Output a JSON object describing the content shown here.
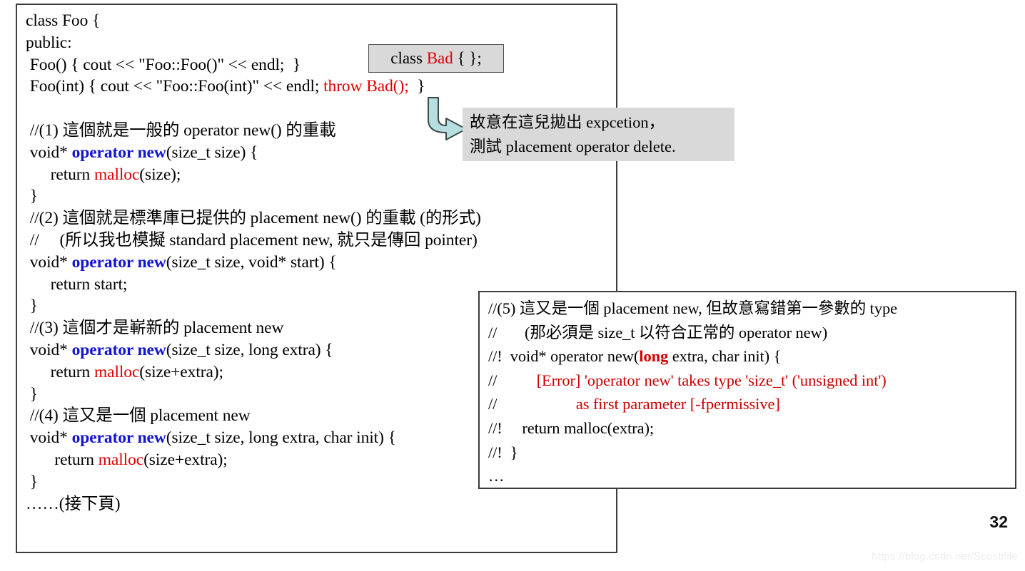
{
  "slide": {
    "page_number": "32",
    "watermark": "https://blog.csdn.net/Scostifile"
  },
  "colors": {
    "keyword_blue": "#1414d2",
    "error_red": "#cc0000",
    "callout_gray": "#d9d9d9",
    "arrow_fill": "#b7dfe0",
    "arrow_stroke": "#3c4a4a",
    "box_border": "#3b3b3b",
    "watermark_gray": "#ededed"
  },
  "main_code": {
    "lines": [
      {
        "id": "l1",
        "parts": [
          {
            "t": "class Foo {",
            "s": "plain"
          }
        ]
      },
      {
        "id": "l2",
        "parts": [
          {
            "t": "public:",
            "s": "plain"
          }
        ]
      },
      {
        "id": "l3",
        "parts": [
          {
            "t": " Foo() { cout << \"Foo::Foo()\" << endl;  }",
            "s": "plain"
          }
        ]
      },
      {
        "id": "l4",
        "parts": [
          {
            "t": " Foo(int) { cout << \"Foo::Foo(int)\" << endl; ",
            "s": "plain"
          },
          {
            "t": "throw Bad();",
            "s": "red"
          },
          {
            "t": "  }",
            "s": "plain"
          }
        ]
      },
      {
        "id": "l5",
        "parts": [
          {
            "t": "",
            "s": "plain"
          }
        ]
      },
      {
        "id": "l6",
        "parts": [
          {
            "t": " //(1) 這個就是一般的 operator new() 的重載",
            "s": "plain"
          }
        ]
      },
      {
        "id": "l7",
        "parts": [
          {
            "t": " void* ",
            "s": "plain"
          },
          {
            "t": "operator new",
            "s": "kw"
          },
          {
            "t": "(size_t size) {",
            "s": "plain"
          }
        ]
      },
      {
        "id": "l8",
        "parts": [
          {
            "t": "      return ",
            "s": "plain"
          },
          {
            "t": "malloc",
            "s": "red"
          },
          {
            "t": "(size);",
            "s": "plain"
          }
        ]
      },
      {
        "id": "l9",
        "parts": [
          {
            "t": " }",
            "s": "plain"
          }
        ]
      },
      {
        "id": "l10",
        "parts": [
          {
            "t": " //(2) 這個就是標準庫已提供的 placement new() 的重載 (的形式)",
            "s": "plain"
          }
        ]
      },
      {
        "id": "l11",
        "parts": [
          {
            "t": " //     (所以我也模擬 standard placement new, 就只是傳回 pointer)",
            "s": "plain"
          }
        ]
      },
      {
        "id": "l12",
        "parts": [
          {
            "t": " void* ",
            "s": "plain"
          },
          {
            "t": "operator new",
            "s": "kw"
          },
          {
            "t": "(size_t size, void* start) {",
            "s": "plain"
          }
        ]
      },
      {
        "id": "l13",
        "parts": [
          {
            "t": "      return start;",
            "s": "plain"
          }
        ]
      },
      {
        "id": "l14",
        "parts": [
          {
            "t": " }",
            "s": "plain"
          }
        ]
      },
      {
        "id": "l15",
        "parts": [
          {
            "t": " //(3) 這個才是嶄新的 placement new",
            "s": "plain"
          }
        ]
      },
      {
        "id": "l16",
        "parts": [
          {
            "t": " void* ",
            "s": "plain"
          },
          {
            "t": "operator new",
            "s": "kw"
          },
          {
            "t": "(size_t size, long extra) {",
            "s": "plain"
          }
        ]
      },
      {
        "id": "l17",
        "parts": [
          {
            "t": "      return ",
            "s": "plain"
          },
          {
            "t": "malloc",
            "s": "red"
          },
          {
            "t": "(size+extra);",
            "s": "plain"
          }
        ]
      },
      {
        "id": "l18",
        "parts": [
          {
            "t": " }",
            "s": "plain"
          }
        ]
      },
      {
        "id": "l19",
        "parts": [
          {
            "t": " //(4) 這又是一個 placement new",
            "s": "plain"
          }
        ]
      },
      {
        "id": "l20",
        "parts": [
          {
            "t": " void* ",
            "s": "plain"
          },
          {
            "t": "operator new",
            "s": "kw"
          },
          {
            "t": "(size_t size, long extra, char init) {",
            "s": "plain"
          }
        ]
      },
      {
        "id": "l21",
        "parts": [
          {
            "t": "       return ",
            "s": "plain"
          },
          {
            "t": "malloc",
            "s": "red"
          },
          {
            "t": "(size+extra);",
            "s": "plain"
          }
        ]
      },
      {
        "id": "l22",
        "parts": [
          {
            "t": " }",
            "s": "plain"
          }
        ]
      },
      {
        "id": "l23",
        "parts": [
          {
            "t": "……(接下頁)",
            "s": "plain"
          }
        ]
      }
    ]
  },
  "class_bad_box": {
    "parts": [
      {
        "t": "class ",
        "s": "plain"
      },
      {
        "t": "Bad",
        "s": "red"
      },
      {
        "t": " { };",
        "s": "plain"
      }
    ]
  },
  "note_callout": {
    "line1": "故意在這兒拋出 expcetion，",
    "line2": "測試 placement operator delete."
  },
  "right_note_box": {
    "lines": [
      {
        "id": "r1",
        "parts": [
          {
            "t": "//(5) 這又是一個 placement new, 但故意寫錯第一參數的 type",
            "s": "plain"
          }
        ]
      },
      {
        "id": "r2",
        "parts": [
          {
            "t": "//       (那必須是 size_t 以符合正常的 operator new)",
            "s": "plain"
          }
        ]
      },
      {
        "id": "r3",
        "parts": [
          {
            "t": "//!  void* operator new(",
            "s": "plain"
          },
          {
            "t": "long",
            "s": "redb"
          },
          {
            "t": " extra, char init) {",
            "s": "plain"
          }
        ]
      },
      {
        "id": "r4",
        "parts": [
          {
            "t": "//          ",
            "s": "plain"
          },
          {
            "t": "[Error] 'operator new' takes type 'size_t' ('unsigned int')",
            "s": "err"
          }
        ]
      },
      {
        "id": "r5",
        "parts": [
          {
            "t": "//                    ",
            "s": "plain"
          },
          {
            "t": "as first parameter [-fpermissive]",
            "s": "err"
          }
        ]
      },
      {
        "id": "r6",
        "parts": [
          {
            "t": "//!     return malloc(extra);",
            "s": "plain"
          }
        ]
      },
      {
        "id": "r7",
        "parts": [
          {
            "t": "//!  }",
            "s": "plain"
          }
        ]
      },
      {
        "id": "r8",
        "parts": [
          {
            "t": "…",
            "s": "plain"
          }
        ]
      }
    ]
  },
  "arrow": {
    "name": "elbow-arrow-down-right"
  }
}
